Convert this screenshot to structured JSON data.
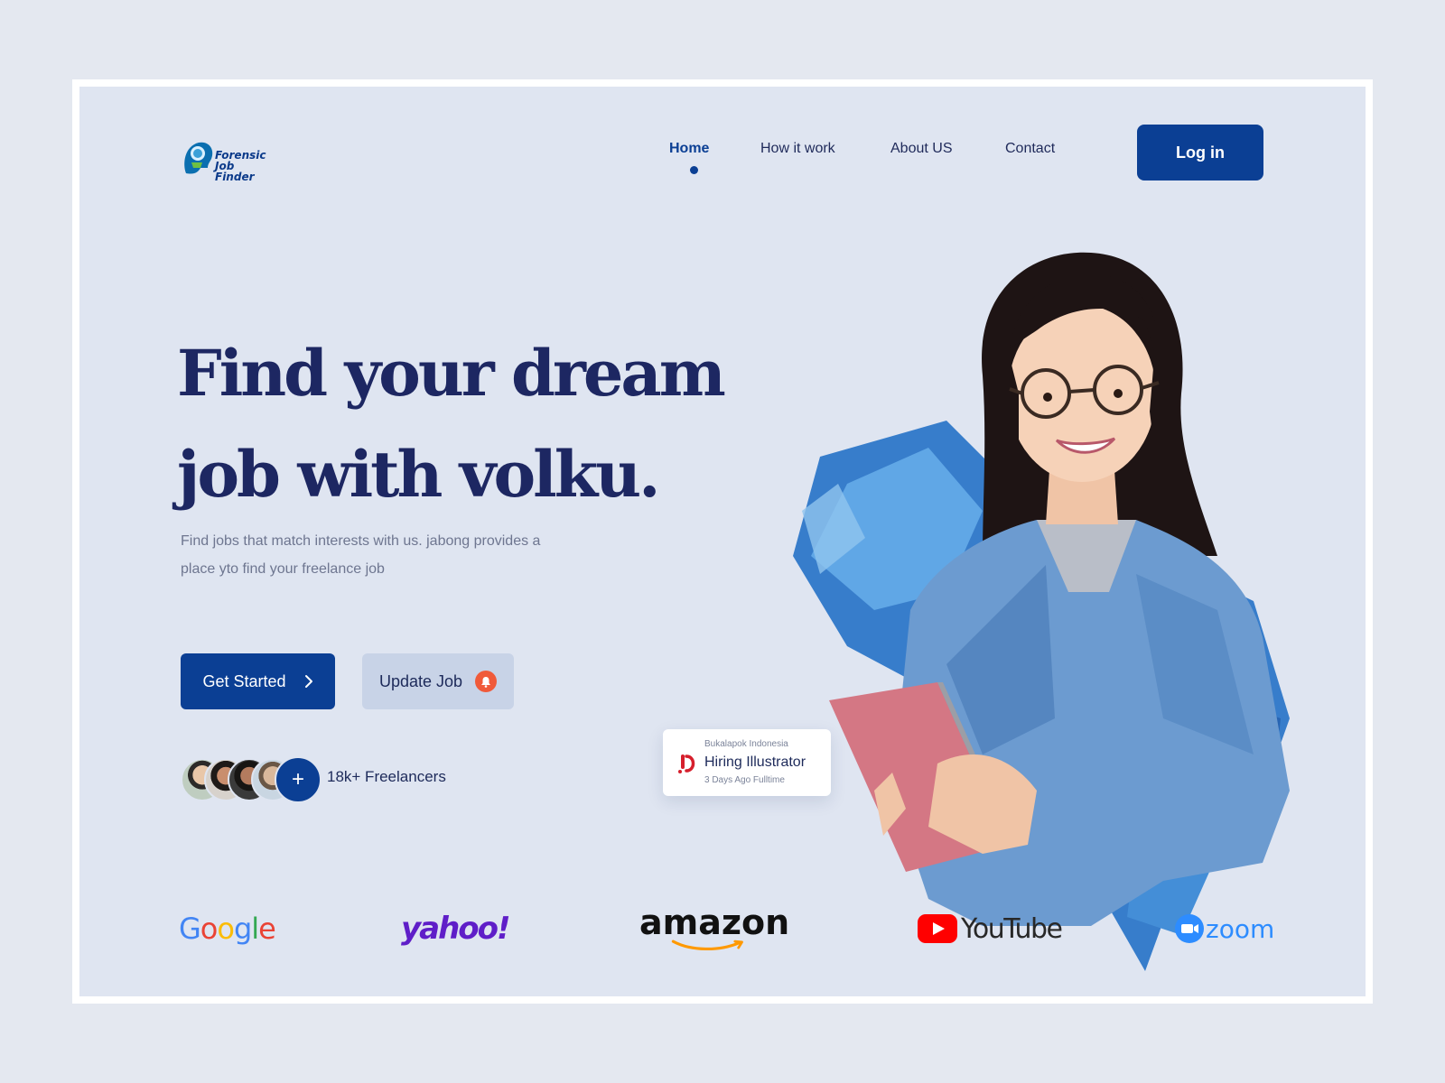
{
  "brand": {
    "logo_line1": "Forensic",
    "logo_line2": "Job Finder"
  },
  "nav": {
    "items": [
      {
        "label": "Home",
        "active": true
      },
      {
        "label": "How it work",
        "active": false
      },
      {
        "label": "About US",
        "active": false
      },
      {
        "label": "Contact",
        "active": false
      }
    ],
    "login_label": "Log in"
  },
  "hero": {
    "headline_line1": "Find your dream",
    "headline_line2": "job with volku.",
    "subtext": "Find jobs that match interests with us. jabong provides a place yto find your freelance job",
    "primary_cta": "Get Started",
    "primary_cta_icon": "chevron-right-icon",
    "secondary_cta": "Update Job",
    "secondary_cta_icon": "bell-icon",
    "plus_symbol": "+",
    "freelancers_count": "18k+ Freelancers"
  },
  "hiring_card": {
    "company": "Bukalapok Indonesia",
    "role": "Hiring Illustrator",
    "meta": "3 Days Ago Fulltime"
  },
  "partners": [
    {
      "name": "Google"
    },
    {
      "name": "yahoo!"
    },
    {
      "name": "amazon"
    },
    {
      "name": "YouTube"
    },
    {
      "name": "zoom"
    }
  ],
  "colors": {
    "primary": "#0b3f94",
    "headline": "#1d2762",
    "page_bg": "#dfe5f1",
    "secondary_btn": "#c8d3e7",
    "bell": "#f05a3a"
  }
}
